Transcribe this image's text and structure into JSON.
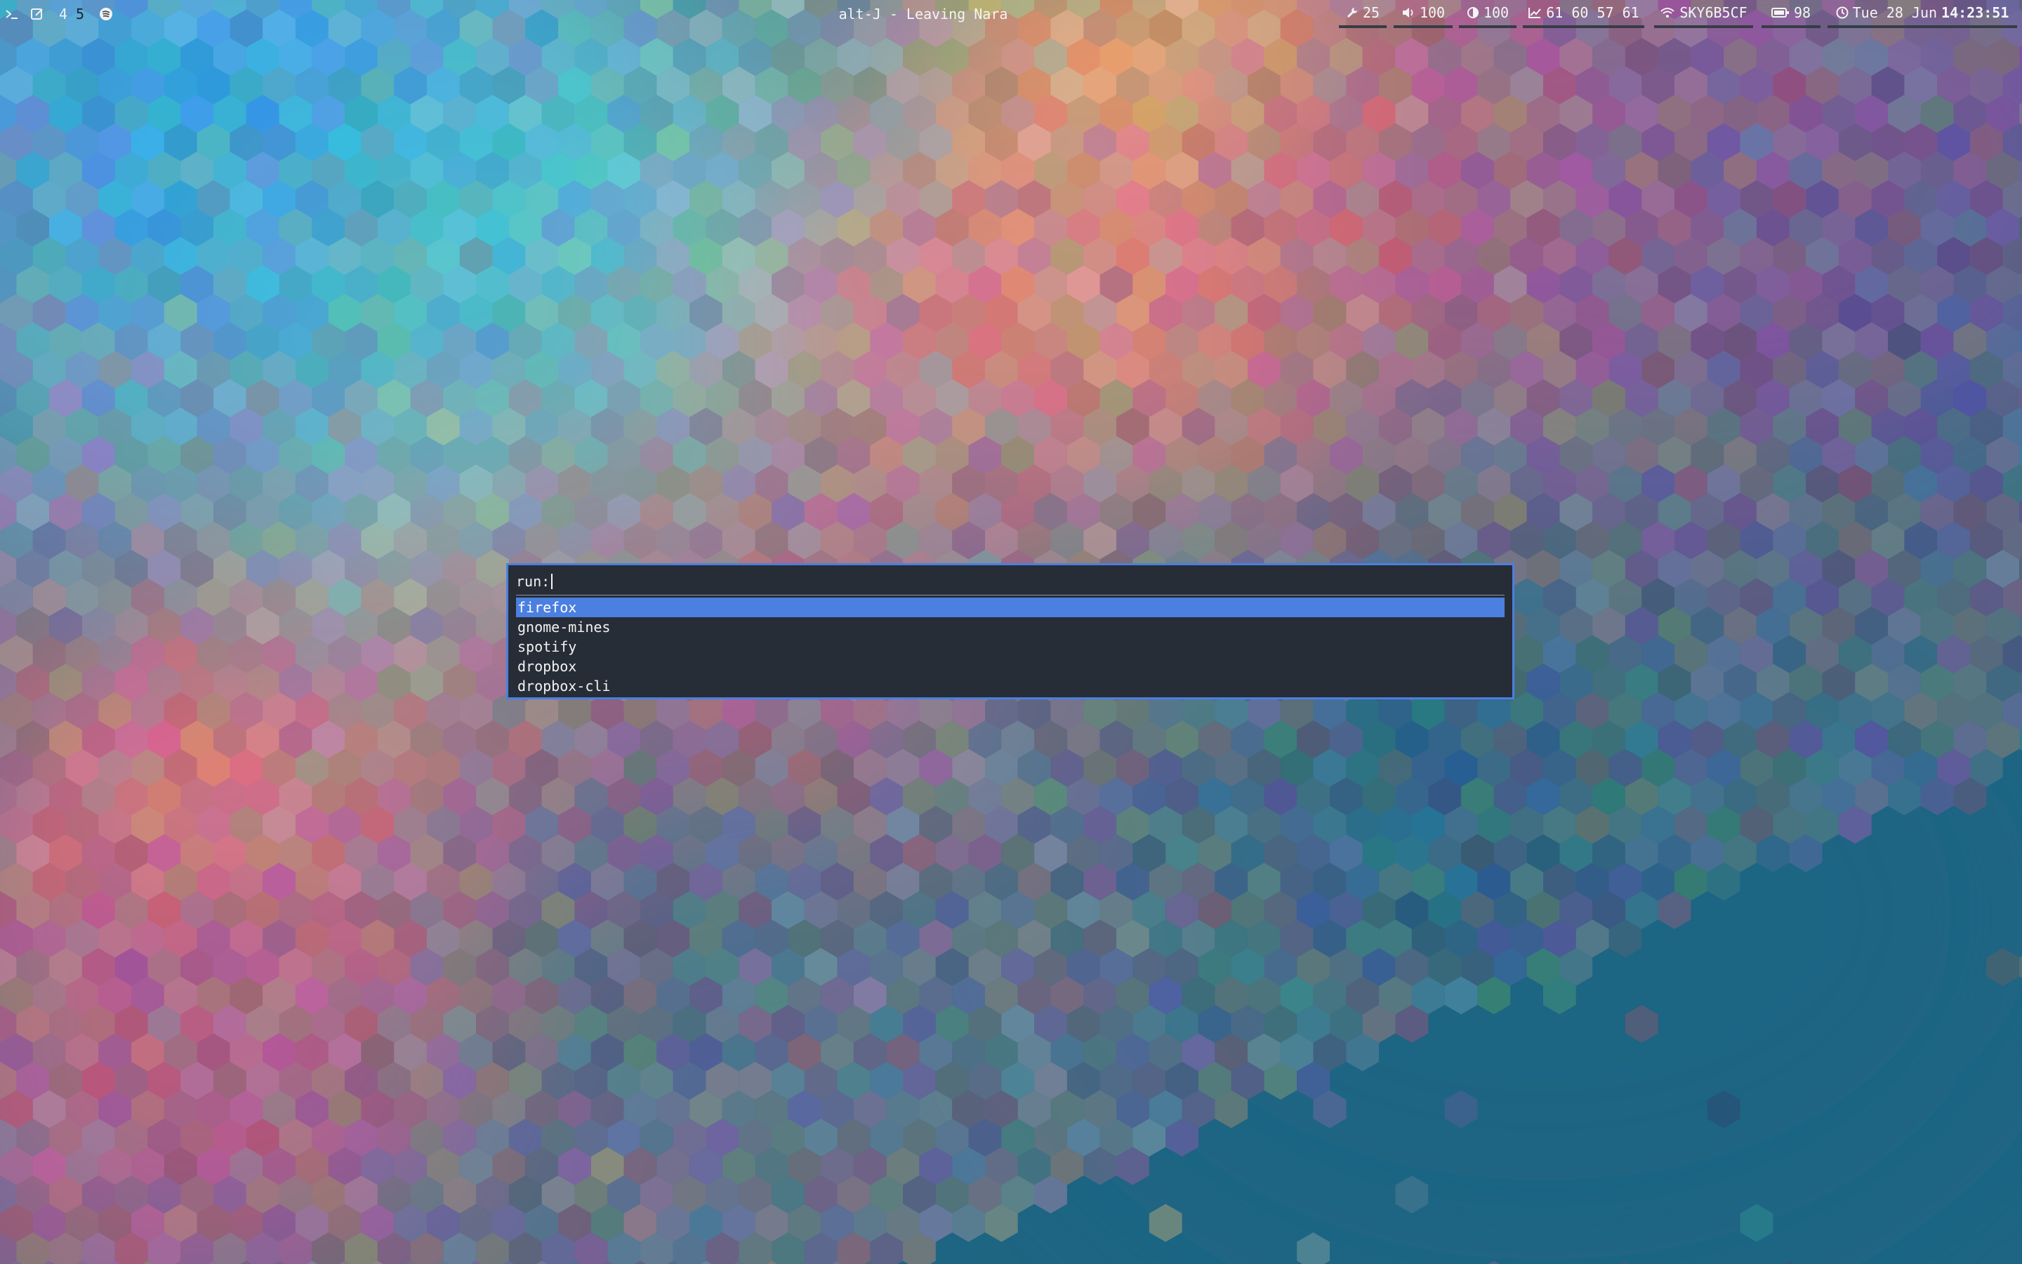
{
  "bar": {
    "left": {
      "terminal_icon": "terminal-icon",
      "edit_icon": "edit-icon",
      "workspaces": [
        "4",
        "5"
      ],
      "focused_workspace": "5",
      "app_icon": "spotify-icon"
    },
    "window_title": "alt-J - Leaving Nara",
    "blocks": {
      "updates": {
        "icon": "wrench-icon",
        "value": "25"
      },
      "volume": {
        "icon": "volume-icon",
        "value": "100"
      },
      "brightness": {
        "icon": "brightness-icon",
        "value": "100"
      },
      "load": {
        "icon": "chart-line-icon",
        "value": "61 60 57 61"
      },
      "wifi": {
        "icon": "wifi-icon",
        "value": "SKY6B5CF"
      },
      "battery": {
        "icon": "battery-icon",
        "value": "98"
      },
      "clock": {
        "icon": "clock-icon",
        "date": "Tue 28 Jun",
        "time": "14:23:51"
      }
    },
    "colors": {
      "block_underline": "#353c45",
      "text": "#f4f4f4"
    }
  },
  "launcher": {
    "prompt": "run:",
    "input_value": "",
    "items": [
      "firefox",
      "gnome-mines",
      "spotify",
      "dropbox",
      "dropbox-cli"
    ],
    "selected_index": 0,
    "colors": {
      "border": "#4b7fe0",
      "background": "#262d36",
      "selection": "#4b7fe0"
    }
  }
}
